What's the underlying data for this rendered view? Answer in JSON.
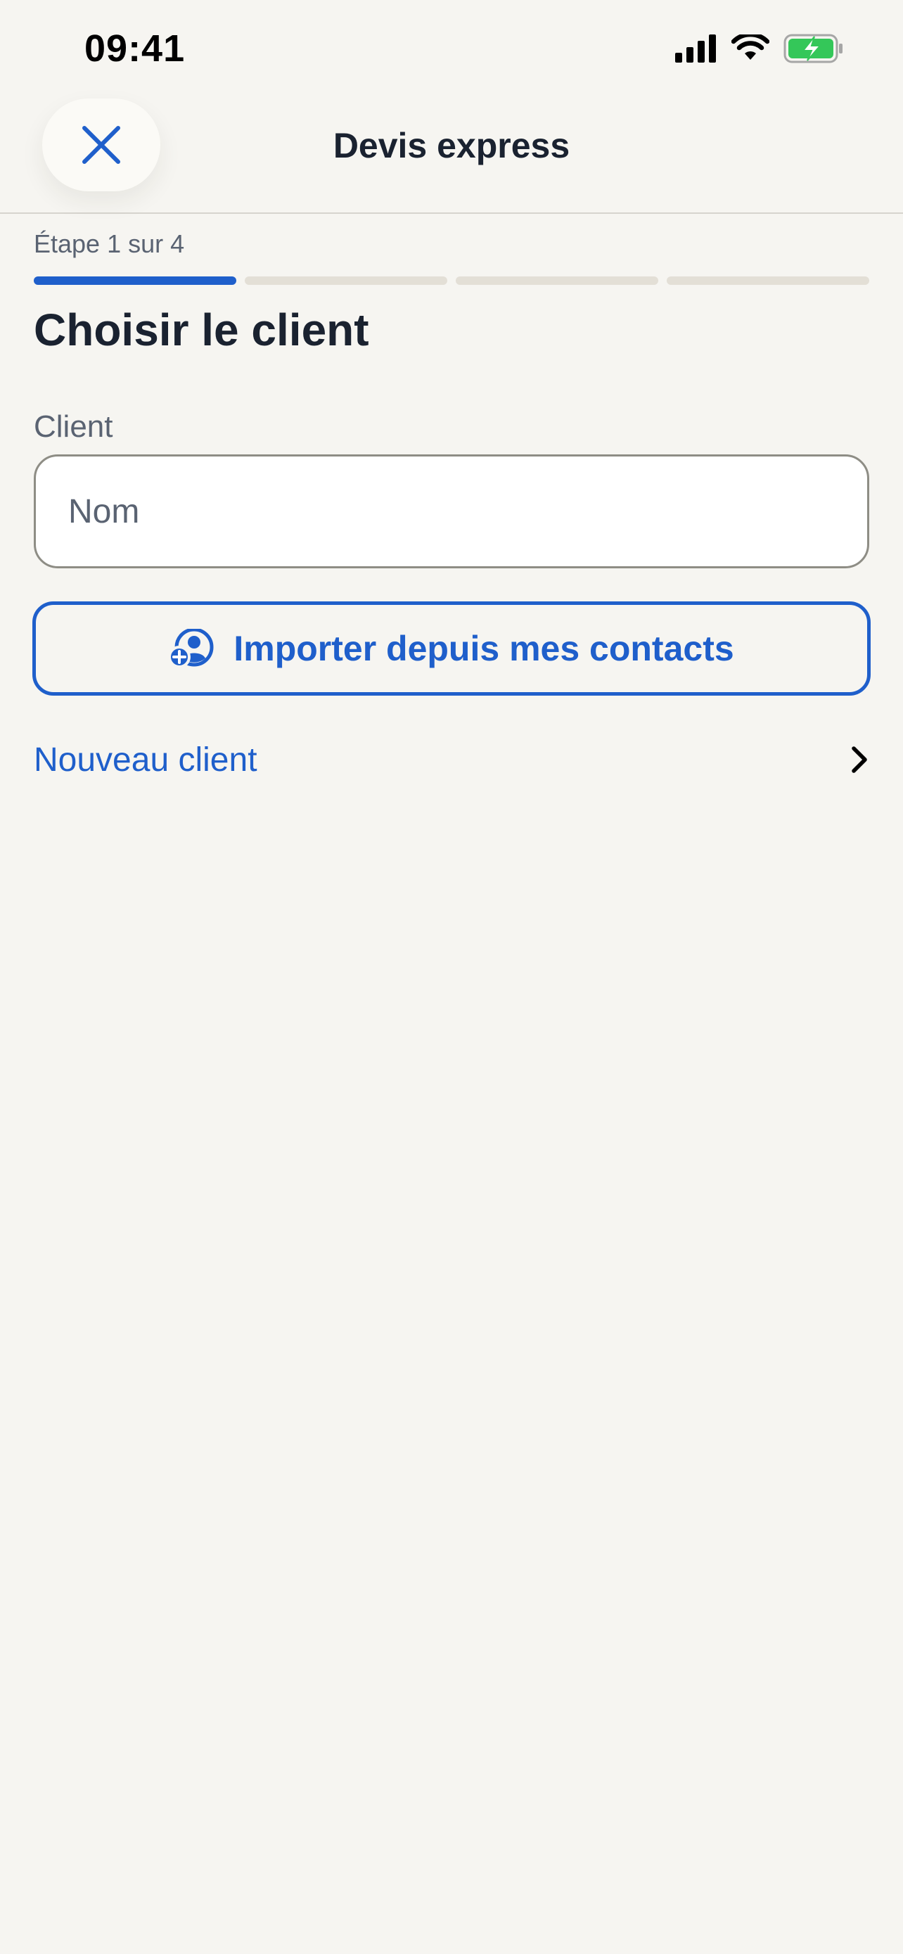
{
  "status_bar": {
    "time": "09:41"
  },
  "nav": {
    "title": "Devis express",
    "close_icon": "close-icon"
  },
  "stepper": {
    "label": "Étape 1 sur 4",
    "current_step": 1,
    "total_steps": 4
  },
  "page": {
    "title": "Choisir le client"
  },
  "client_field": {
    "label": "Client",
    "placeholder": "Nom",
    "value": ""
  },
  "import_button": {
    "label": "Importer depuis mes contacts",
    "icon": "add-contact-icon"
  },
  "new_client": {
    "label": "Nouveau client",
    "icon": "chevron-right-icon"
  },
  "colors": {
    "background": "#F6F5F1",
    "accent": "#1F5FCB",
    "text_primary": "#1A2230",
    "text_secondary": "#5A6372",
    "progress_inactive": "#E3DFD6",
    "battery_fill": "#34C759"
  }
}
